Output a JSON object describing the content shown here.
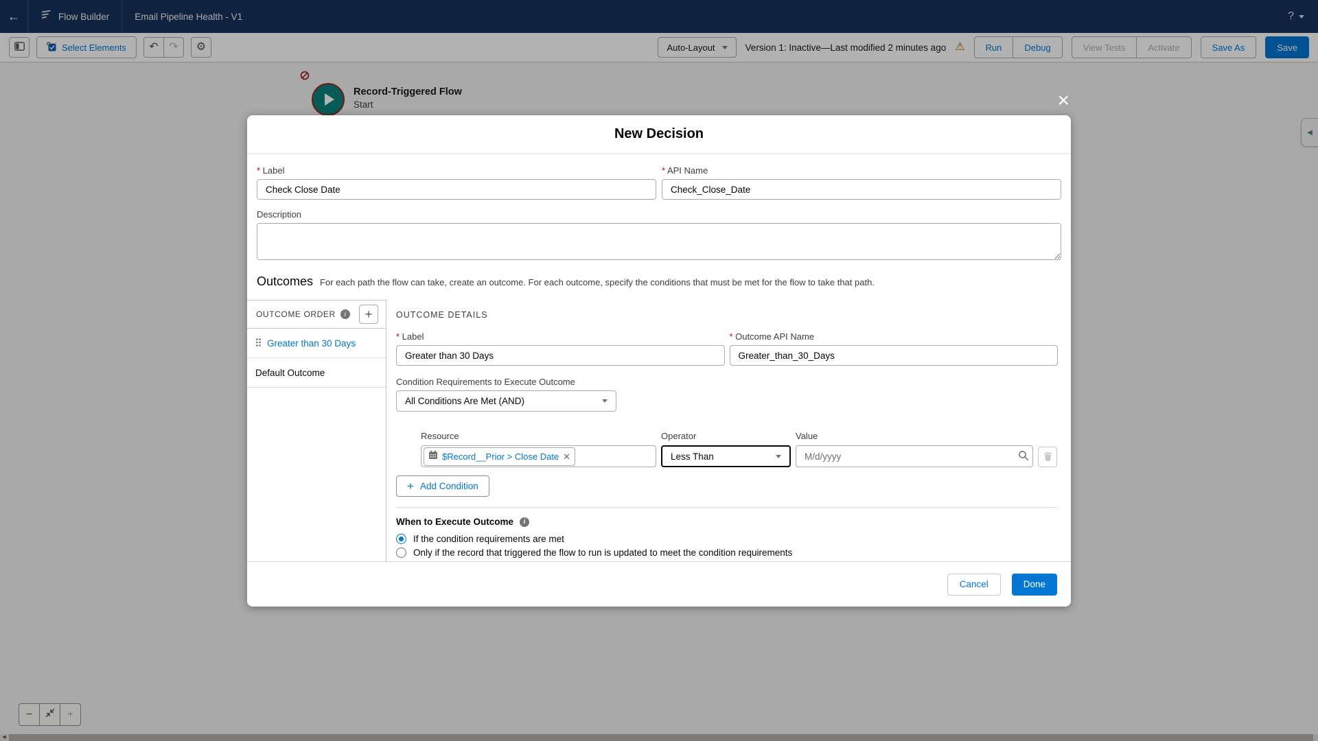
{
  "header": {
    "app_name": "Flow Builder",
    "flow_title": "Email Pipeline Health - V1"
  },
  "toolbar": {
    "select_elements": "Select Elements",
    "layout_mode": "Auto-Layout",
    "version_status": "Version 1: Inactive—Last modified 2 minutes ago",
    "run": "Run",
    "debug": "Debug",
    "view_tests": "View Tests",
    "activate": "Activate",
    "save_as": "Save As",
    "save": "Save"
  },
  "canvas": {
    "start_node": {
      "type_label": "Record-Triggered Flow",
      "name": "Start"
    }
  },
  "modal": {
    "title": "New Decision",
    "label_field": {
      "label": "Label",
      "value": "Check Close Date"
    },
    "api_field": {
      "label": "API Name",
      "value": "Check_Close_Date"
    },
    "description_field": {
      "label": "Description",
      "value": ""
    },
    "outcomes": {
      "heading": "Outcomes",
      "subtext": "For each path the flow can take, create an outcome. For each outcome, specify the conditions that must be met for the flow to take that path.",
      "order_heading": "OUTCOME ORDER",
      "order_items": [
        {
          "label": "Greater than 30 Days",
          "selected": true
        },
        {
          "label": "Default Outcome",
          "selected": false
        }
      ],
      "details": {
        "heading": "OUTCOME DETAILS",
        "label_field": {
          "label": "Label",
          "value": "Greater than 30 Days"
        },
        "api_field": {
          "label": "Outcome API Name",
          "value": "Greater_than_30_Days"
        },
        "condition_requirements": {
          "label": "Condition Requirements to Execute Outcome",
          "value": "All Conditions Are Met (AND)"
        },
        "condition_row": {
          "resource_label": "Resource",
          "resource_value": "$Record__Prior > Close Date",
          "operator_label": "Operator",
          "operator_value": "Less Than",
          "value_label": "Value",
          "value_placeholder": "M/d/yyyy"
        },
        "add_condition": "Add Condition",
        "when_to_execute": {
          "heading": "When to Execute Outcome",
          "options": [
            {
              "label": "If the condition requirements are met",
              "selected": true
            },
            {
              "label": "Only if the record that triggered the flow to run is updated to meet the condition requirements",
              "selected": false
            }
          ]
        }
      }
    },
    "footer": {
      "cancel": "Cancel",
      "done": "Done"
    }
  },
  "icons": {
    "back": "←",
    "help": "?",
    "undo": "↶",
    "redo": "↷",
    "gear": "⚙",
    "warning": "⚠",
    "close": "×",
    "plus": "+",
    "minus": "−",
    "remove": "✕",
    "left_arrow_small": "◀"
  },
  "colors": {
    "brand_blue": "#0176d3",
    "header_navy": "#16325c",
    "start_node_teal": "#0b827c",
    "error_red": "#ba0517",
    "warning_orange": "#a86403"
  }
}
